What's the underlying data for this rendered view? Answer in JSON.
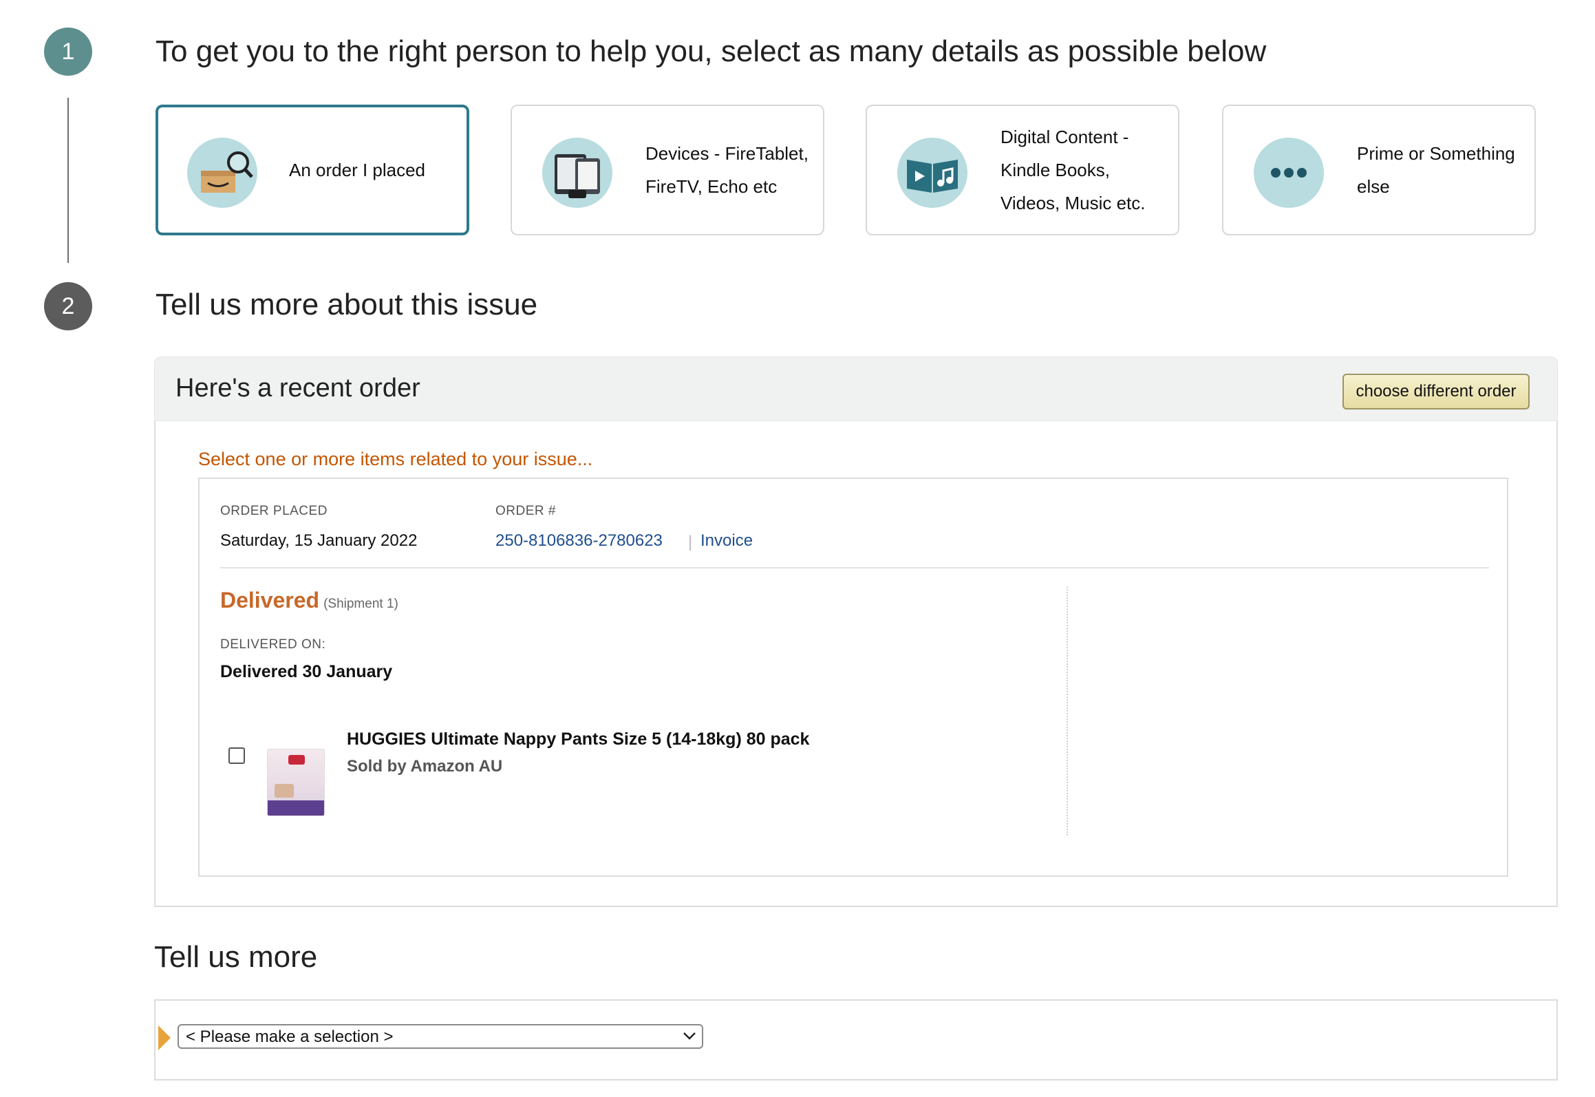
{
  "step1": {
    "number": "1",
    "heading": "To get you to the right person to help you, select as many details as possible below",
    "cards": [
      {
        "label": "An order I placed",
        "icon": "order-search-icon",
        "selected": true
      },
      {
        "label": "Devices - FireTablet, FireTV, Echo etc",
        "icon": "devices-icon",
        "selected": false
      },
      {
        "label": "Digital Content - Kindle Books, Videos, Music etc.",
        "icon": "digital-content-icon",
        "selected": false
      },
      {
        "label": "Prime or Something else",
        "icon": "more-icon",
        "selected": false
      }
    ]
  },
  "step2": {
    "number": "2",
    "heading": "Tell us more about this issue"
  },
  "recent_order": {
    "title": "Here's a recent order",
    "choose_button": "choose different order",
    "select_prompt": "Select one or more items related to your issue...",
    "order_placed_label": "ORDER PLACED",
    "order_placed_value": "Saturday, 15 January 2022",
    "order_number_label": "ORDER #",
    "order_number": "250-8106836-2780623",
    "separator": "|",
    "invoice_link": "Invoice",
    "status": "Delivered",
    "shipment": "(Shipment 1)",
    "delivered_on_label": "DELIVERED ON:",
    "delivered_date": "Delivered 30 January",
    "item": {
      "title": "HUGGIES Ultimate Nappy Pants Size 5 (14-18kg) 80 pack",
      "seller": "Sold by Amazon AU",
      "checked": false
    }
  },
  "tell_more": {
    "heading": "Tell us more",
    "select_value": "< Please make a selection >"
  },
  "colors": {
    "accent_teal": "#2e7a8c",
    "step1_circle": "#5e8f8f",
    "step2_circle": "#5c5c5c",
    "prompt_orange": "#c45500",
    "status_orange": "#c7682a",
    "link_blue": "#1f4e8c",
    "marker_orange": "#e8a33c"
  }
}
